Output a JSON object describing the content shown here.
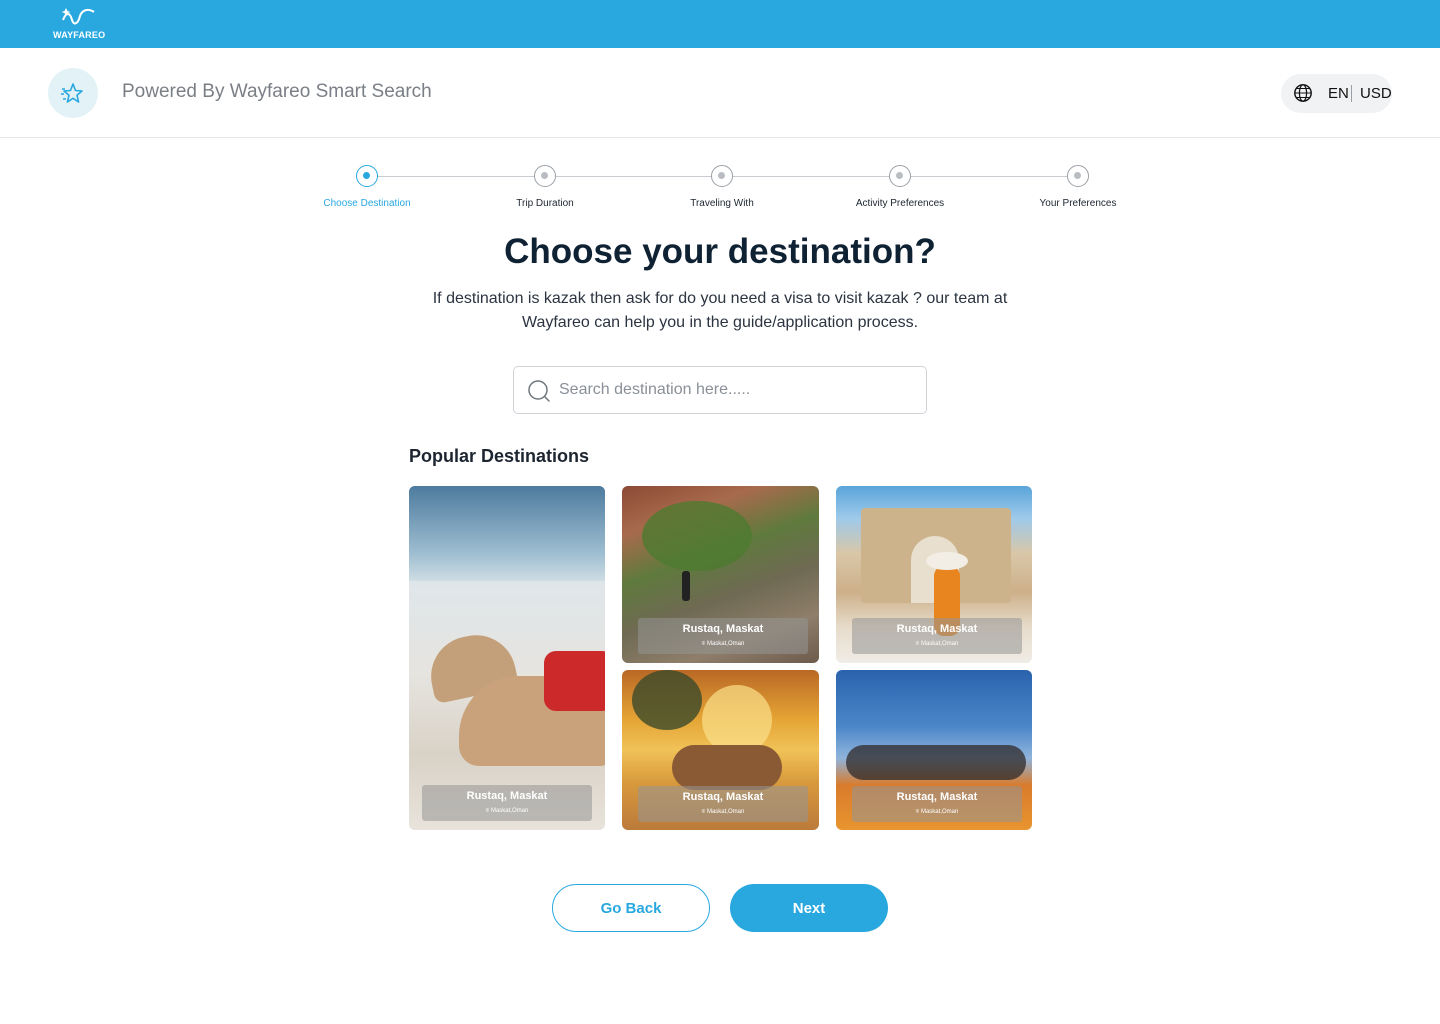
{
  "topbar": {
    "logo_text": "WAYFAREO",
    "bg_color": "#29a8e0"
  },
  "header": {
    "powered_text": "Powered By Wayfareo Smart Search",
    "language": "EN",
    "currency": "USD",
    "icons": {
      "spark": "sparkle-icon",
      "globe": "globe-icon"
    }
  },
  "stepper": {
    "active_color": "#29a8e0",
    "steps": [
      {
        "label": "Choose Destination",
        "active": true
      },
      {
        "label": "Trip Duration",
        "active": false
      },
      {
        "label": "Traveling With",
        "active": false
      },
      {
        "label": "Activity Preferences",
        "active": false
      },
      {
        "label": "Your Preferences",
        "active": false
      }
    ]
  },
  "main": {
    "title": "Choose your destination?",
    "description": "If destination is kazak then ask for do you need a visa to visit kazak ? our team at Wayfareo can help you in the guide/application process.",
    "search": {
      "placeholder": "Search destination here.....",
      "value": "",
      "icon": "search-icon"
    },
    "popular_title": "Popular Destinations",
    "destinations": [
      {
        "name": "Rustaq, Maskat",
        "location": "Maskat,Oman",
        "scene": "camel on beach"
      },
      {
        "name": "Rustaq, Maskat",
        "location": "Maskat,Oman",
        "scene": "canyon hiker"
      },
      {
        "name": "Rustaq, Maskat",
        "location": "Maskat,Oman",
        "scene": "ancient arch"
      },
      {
        "name": "Rustaq, Maskat",
        "location": "Maskat,Oman",
        "scene": "camel at desert sunset"
      },
      {
        "name": "Rustaq, Maskat",
        "location": "Maskat,Oman",
        "scene": "group on sand dune"
      }
    ]
  },
  "actions": {
    "back_label": "Go Back",
    "next_label": "Next"
  }
}
